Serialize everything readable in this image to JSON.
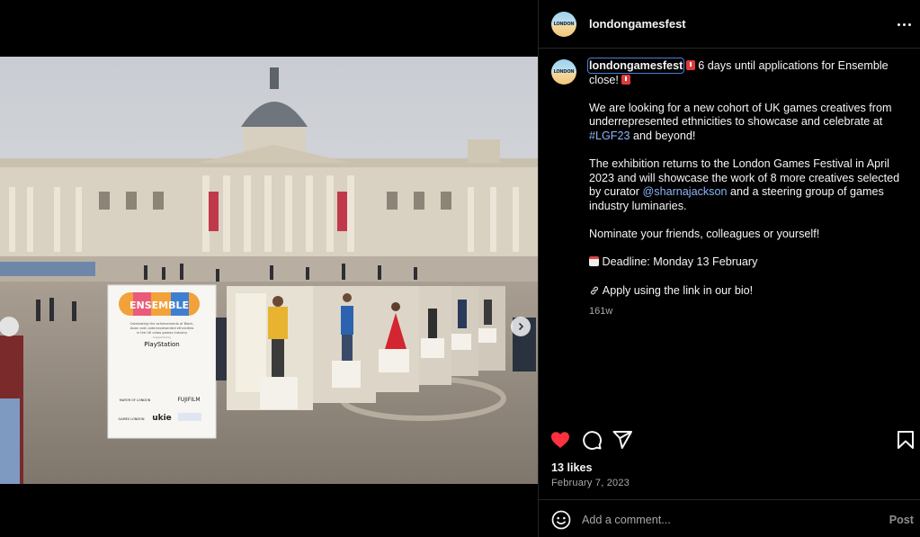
{
  "post": {
    "username": "londongamesfest",
    "avatar_text": "LONDON",
    "caption": {
      "username": "londongamesfest",
      "line1": " 6 days until applications for Ensemble close! ",
      "para2_a": "We are looking for a new cohort of UK games creatives from underrepresented ethnicities to showcase and celebrate at ",
      "hashtag": "#LGF23",
      "para2_b": " and beyond!",
      "para3_a": "The exhibition returns to the London Games Festival in April 2023 and will showcase the work of 8 more creatives selected by curator ",
      "mention": "@sharnajackson",
      "para3_b": " and a steering group of games industry luminaries.",
      "para4": "Nominate your friends, colleagues or yourself!",
      "para5": " Deadline: Monday 13 February",
      "para6": " Apply using the link in our bio!"
    },
    "time_ago": "161w",
    "likes": "13 likes",
    "date": "February 7, 2023",
    "liked": true,
    "comment_placeholder": "Add a comment...",
    "post_label": "Post"
  },
  "photo": {
    "sign_title": "ENSEMBLE",
    "sign_text": "Celebrating the achievements of Black, Asian and underrepresented ethnicities in the UK video games industry",
    "sign_supported": "Supported by",
    "sign_brand": "PlayStation",
    "sign_partner1": "MAYOR OF LONDON",
    "sign_partner2": "FUJIFILM",
    "sign_partner3": "GAMES LONDON",
    "sign_partner4": "ukie"
  },
  "carousel": {
    "slides": 4,
    "active": 1
  },
  "colors": {
    "background": "#000000",
    "like_red": "#ff3040",
    "link_blue": "#8ab4f8",
    "muted_text": "#a8a8a8",
    "divider": "#262626"
  },
  "icons": [
    "more-options-icon",
    "heart-icon",
    "comment-icon",
    "share-icon",
    "bookmark-icon",
    "emoji-icon",
    "chevron-right-icon"
  ]
}
